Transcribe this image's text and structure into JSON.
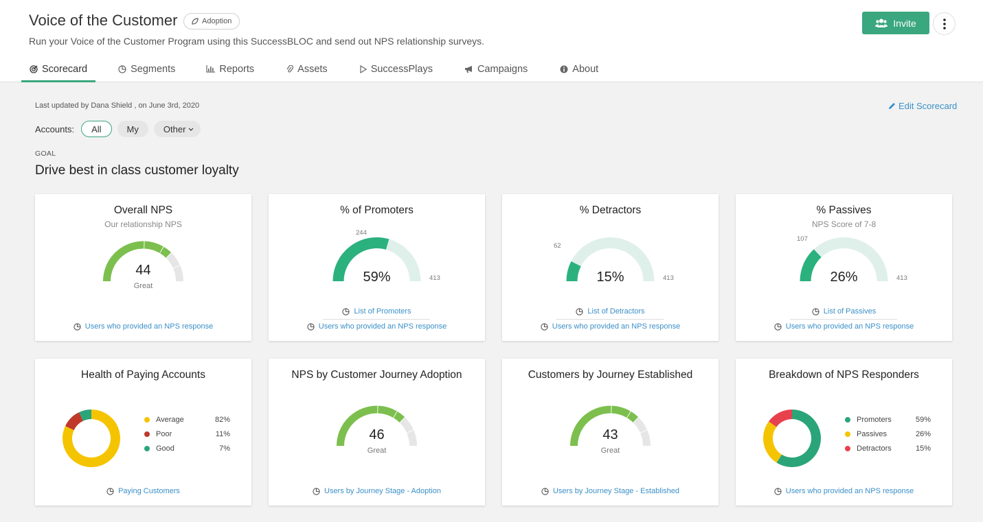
{
  "header": {
    "title": "Voice of the Customer",
    "tag": "Adoption",
    "subtitle": "Run your Voice of the Customer Program using this SuccessBLOC and send out NPS relationship surveys.",
    "invite_label": "Invite",
    "tabs": [
      {
        "label": "Scorecard",
        "icon": "scorecard-icon",
        "active": true
      },
      {
        "label": "Segments",
        "icon": "pie-icon"
      },
      {
        "label": "Reports",
        "icon": "bar-chart-icon"
      },
      {
        "label": "Assets",
        "icon": "paperclip-icon"
      },
      {
        "label": "SuccessPlays",
        "icon": "play-icon"
      },
      {
        "label": "Campaigns",
        "icon": "megaphone-icon"
      },
      {
        "label": "About",
        "icon": "info-icon"
      }
    ]
  },
  "toolbar": {
    "updated": "Last updated by Dana Shield , on June 3rd, 2020",
    "edit_label": "Edit Scorecard",
    "accounts_label": "Accounts:",
    "filters": [
      "All",
      "My",
      "Other"
    ],
    "active_filter": "All"
  },
  "goal": {
    "label": "GOAL",
    "title": "Drive best in class customer loyalty"
  },
  "cards": {
    "overall_nps": {
      "title": "Overall NPS",
      "subtitle": "Our relationship NPS",
      "value": "44",
      "caption": "Great",
      "link": "Users who provided an NPS response"
    },
    "promoters": {
      "title": "% of Promoters",
      "value": "59%",
      "count": "244",
      "total": "413",
      "fraction": 0.59,
      "list_link": "List of Promoters",
      "link": "Users who provided an NPS response"
    },
    "detractors": {
      "title": "% Detractors",
      "value": "15%",
      "count": "62",
      "total": "413",
      "fraction": 0.15,
      "list_link": "List of Detractors",
      "link": "Users who provided an NPS response"
    },
    "passives": {
      "title": "% Passives",
      "subtitle": "NPS Score of 7-8",
      "value": "26%",
      "count": "107",
      "total": "413",
      "fraction": 0.26,
      "list_link": "List of Passives",
      "link": "Users who provided an NPS response"
    },
    "health": {
      "title": "Health of Paying Accounts",
      "legend": [
        {
          "label": "Average",
          "value": "82%",
          "color": "#f5c400"
        },
        {
          "label": "Poor",
          "value": "11%",
          "color": "#c0392b"
        },
        {
          "label": "Good",
          "value": "7%",
          "color": "#2aa57a"
        }
      ],
      "link": "Paying Customers"
    },
    "journey_adoption": {
      "title": "NPS by Customer Journey Adoption",
      "value": "46",
      "caption": "Great",
      "link": "Users by Journey Stage - Adoption"
    },
    "journey_established": {
      "title": "Customers by Journey Established",
      "value": "43",
      "caption": "Great",
      "link": "Users by Journey Stage - Established"
    },
    "breakdown": {
      "title": "Breakdown of NPS Responders",
      "legend": [
        {
          "label": "Promoters",
          "value": "59%",
          "color": "#2aa57a"
        },
        {
          "label": "Passives",
          "value": "26%",
          "color": "#f5c400"
        },
        {
          "label": "Detractors",
          "value": "15%",
          "color": "#e8414e"
        }
      ],
      "link": "Users who provided an NPS response"
    }
  },
  "colors": {
    "accent": "#3aa77e",
    "link": "#3a8fc7",
    "gauge_green": "#7cbf4e",
    "gauge_teal": "#2bb17e",
    "gauge_track": "#dff0ea",
    "gauge_gray": "#e6e6e6"
  }
}
